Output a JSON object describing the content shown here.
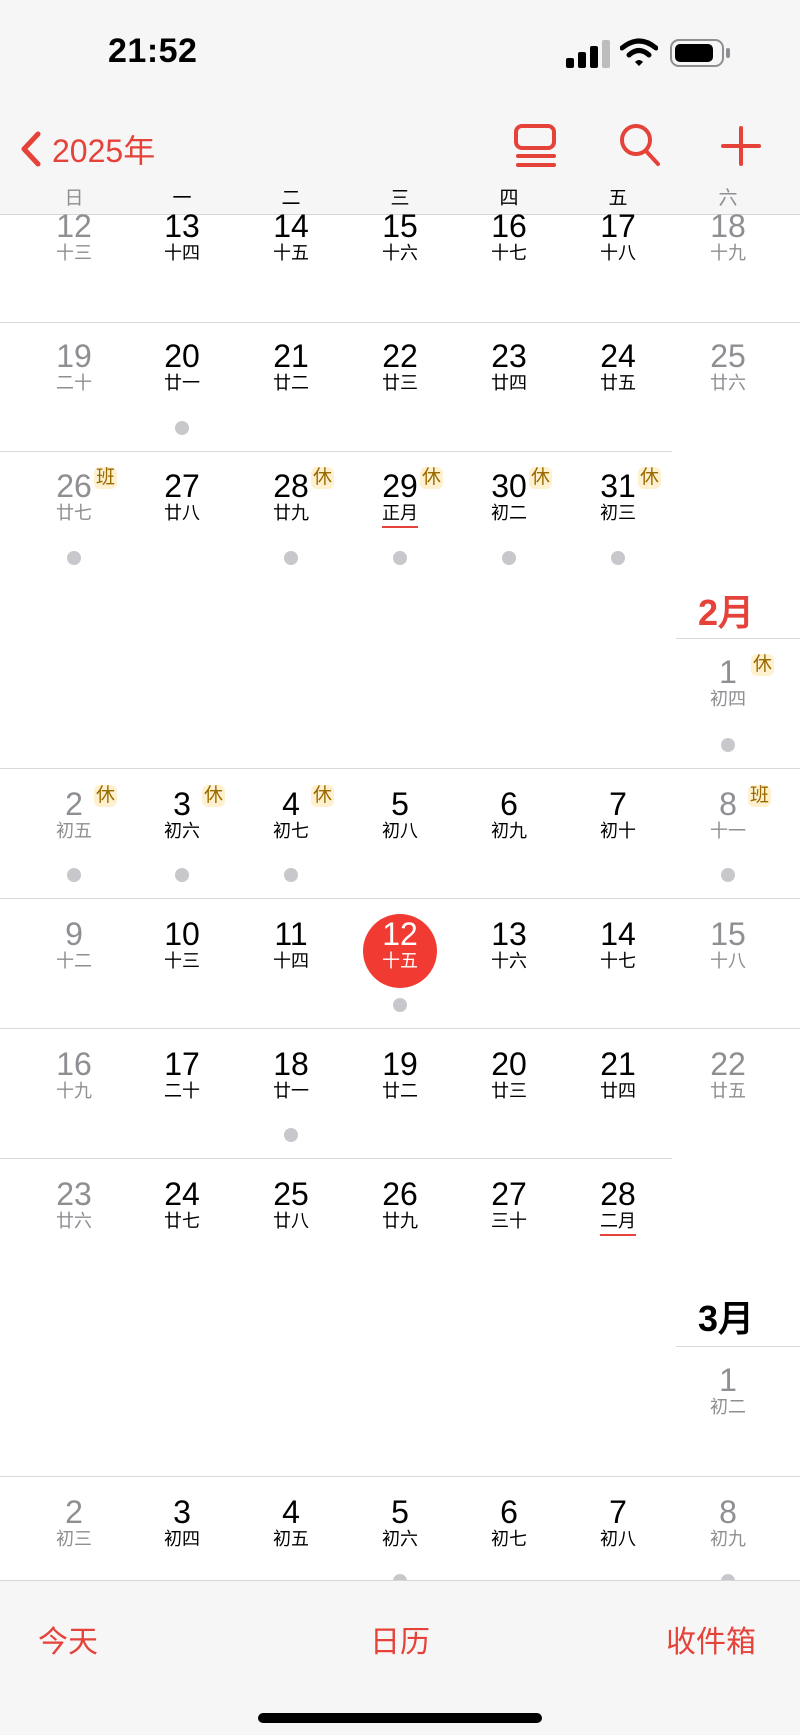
{
  "status": {
    "time": "21:52"
  },
  "header": {
    "back_label": "2025年"
  },
  "weekdays": [
    "日",
    "一",
    "二",
    "三",
    "四",
    "五",
    "六"
  ],
  "icons": {
    "back": "chevron-left-icon",
    "list": "list-view-icon",
    "search": "search-icon",
    "add": "plus-icon",
    "accent": "#e5423a"
  },
  "months": {
    "feb": "2月",
    "mar": "3月"
  },
  "rows": [
    {
      "days": [
        {
          "n": "12",
          "l": "十三"
        },
        {
          "n": "13",
          "l": "十四"
        },
        {
          "n": "14",
          "l": "十五"
        },
        {
          "n": "15",
          "l": "十六"
        },
        {
          "n": "16",
          "l": "十七"
        },
        {
          "n": "17",
          "l": "十八"
        },
        {
          "n": "18",
          "l": "十九"
        }
      ]
    },
    {
      "days": [
        {
          "n": "19",
          "l": "二十"
        },
        {
          "n": "20",
          "l": "廿一"
        },
        {
          "n": "21",
          "l": "廿二"
        },
        {
          "n": "22",
          "l": "廿三"
        },
        {
          "n": "23",
          "l": "廿四"
        },
        {
          "n": "24",
          "l": "廿五"
        },
        {
          "n": "25",
          "l": "廿六"
        }
      ]
    },
    {
      "days": [
        {
          "n": "26",
          "l": "廿七",
          "badge": "班"
        },
        {
          "n": "27",
          "l": "廿八"
        },
        {
          "n": "28",
          "l": "廿九",
          "badge": "休"
        },
        {
          "n": "29",
          "l": "正月",
          "badge": "休"
        },
        {
          "n": "30",
          "l": "初二",
          "badge": "休"
        },
        {
          "n": "31",
          "l": "初三",
          "badge": "休"
        }
      ]
    },
    {
      "days": [
        {
          "n": "1",
          "l": "初四",
          "badge": "休"
        }
      ]
    },
    {
      "days": [
        {
          "n": "2",
          "l": "初五",
          "badge": "休"
        },
        {
          "n": "3",
          "l": "初六",
          "badge": "休"
        },
        {
          "n": "4",
          "l": "初七",
          "badge": "休"
        },
        {
          "n": "5",
          "l": "初八"
        },
        {
          "n": "6",
          "l": "初九"
        },
        {
          "n": "7",
          "l": "初十"
        },
        {
          "n": "8",
          "l": "十一",
          "badge": "班"
        }
      ]
    },
    {
      "days": [
        {
          "n": "9",
          "l": "十二"
        },
        {
          "n": "10",
          "l": "十三"
        },
        {
          "n": "11",
          "l": "十四"
        },
        {
          "n": "12",
          "l": "十五"
        },
        {
          "n": "13",
          "l": "十六"
        },
        {
          "n": "14",
          "l": "十七"
        },
        {
          "n": "15",
          "l": "十八"
        }
      ]
    },
    {
      "days": [
        {
          "n": "16",
          "l": "十九"
        },
        {
          "n": "17",
          "l": "二十"
        },
        {
          "n": "18",
          "l": "廿一"
        },
        {
          "n": "19",
          "l": "廿二"
        },
        {
          "n": "20",
          "l": "廿三"
        },
        {
          "n": "21",
          "l": "廿四"
        },
        {
          "n": "22",
          "l": "廿五"
        }
      ]
    },
    {
      "days": [
        {
          "n": "23",
          "l": "廿六"
        },
        {
          "n": "24",
          "l": "廿七"
        },
        {
          "n": "25",
          "l": "廿八"
        },
        {
          "n": "26",
          "l": "廿九"
        },
        {
          "n": "27",
          "l": "三十"
        },
        {
          "n": "28",
          "l": "二月"
        }
      ]
    },
    {
      "days": [
        {
          "n": "1",
          "l": "初二"
        }
      ]
    },
    {
      "days": [
        {
          "n": "2",
          "l": "初三"
        },
        {
          "n": "3",
          "l": "初四"
        },
        {
          "n": "4",
          "l": "初五"
        },
        {
          "n": "5",
          "l": "初六"
        },
        {
          "n": "6",
          "l": "初七"
        },
        {
          "n": "7",
          "l": "初八"
        },
        {
          "n": "8",
          "l": "初九"
        }
      ]
    }
  ],
  "toolbar": {
    "today": "今天",
    "calendars": "日历",
    "inbox": "收件箱"
  }
}
